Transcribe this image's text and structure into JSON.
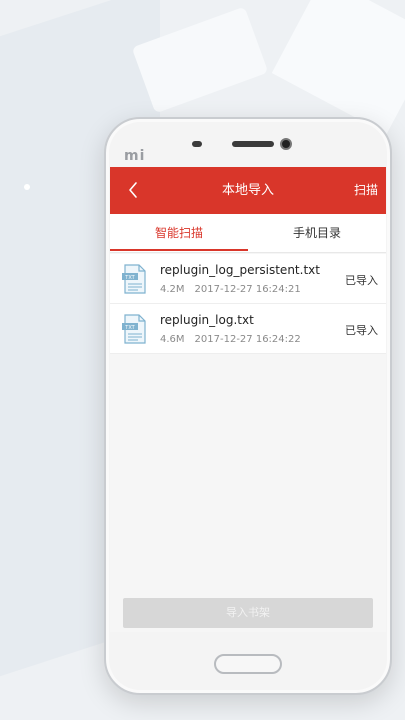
{
  "header": {
    "title": "本地导入",
    "action": "扫描"
  },
  "tabs": [
    {
      "label": "智能扫描",
      "active": true
    },
    {
      "label": "手机目录",
      "active": false
    }
  ],
  "files": [
    {
      "name": "replugin_log_persistent.txt",
      "size": "4.2M",
      "date": "2017-12-27 16:24:21",
      "status": "已导入",
      "icon": "txt-file-icon"
    },
    {
      "name": "replugin_log.txt",
      "size": "4.6M",
      "date": "2017-12-27 16:24:22",
      "status": "已导入",
      "icon": "txt-file-icon"
    }
  ],
  "footer": {
    "import_button": "导入书架"
  },
  "phone": {
    "brand": "mi"
  },
  "colors": {
    "accent": "#d9362a",
    "disabled_button": "#d7d7d7"
  }
}
